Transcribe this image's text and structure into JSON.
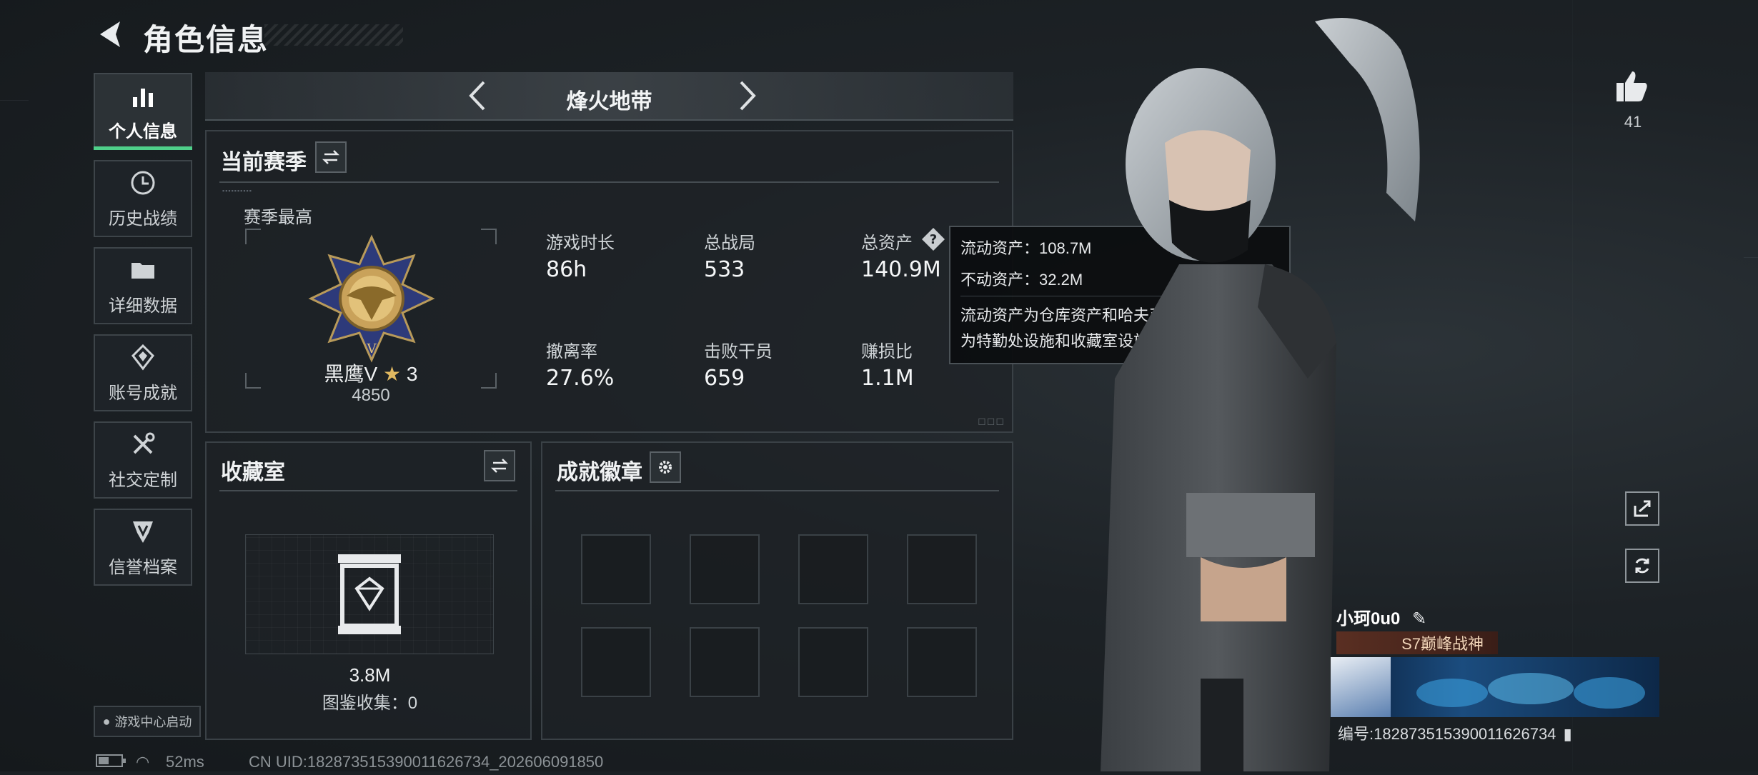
{
  "header": {
    "title": "角色信息"
  },
  "sidebar": {
    "items": [
      {
        "label": "个人信息",
        "icon": "bar-chart-icon"
      },
      {
        "label": "历史战绩",
        "icon": "clock-icon"
      },
      {
        "label": "详细数据",
        "icon": "folder-icon"
      },
      {
        "label": "账号成就",
        "icon": "achievement-icon"
      },
      {
        "label": "社交定制",
        "icon": "tools-icon"
      },
      {
        "label": "信誉档案",
        "icon": "shield-icon"
      }
    ],
    "game_center": "游戏中心启动"
  },
  "mode": {
    "title": "烽火地带"
  },
  "season_panel": {
    "title": "当前赛季",
    "best_label": "赛季最高",
    "rank_name": "黑鹰V",
    "rank_stars": "3",
    "rank_points": "4850",
    "stats": [
      {
        "label": "游戏时长",
        "value": "86h"
      },
      {
        "label": "总战局",
        "value": "533"
      },
      {
        "label": "总资产",
        "value": "140.9M"
      },
      {
        "label": "撤离率",
        "value": "27.6%"
      },
      {
        "label": "击败干员",
        "value": "659"
      },
      {
        "label": "赚损比",
        "value": "1.1M"
      }
    ]
  },
  "tooltip": {
    "liquid": "流动资产：108.7M",
    "fixed": "不动资产：32.2M",
    "desc_line1": "流动资产为仓库资产和哈夫币，不动资产",
    "desc_line2": "为特勤处设施和收藏室设施"
  },
  "collection_panel": {
    "title": "收藏室",
    "value": "3.8M",
    "catalog": "图鉴收集：0"
  },
  "badge_panel": {
    "title": "成就徽章",
    "slots": 8
  },
  "player": {
    "likes": "41",
    "name": "小珂0u0",
    "title_tag": "S7巅峰战神",
    "uid_line": "编号:182873515390011626734"
  },
  "footer": {
    "ping": "52ms",
    "uid": "CN UID:182873515390011626734_202606091850"
  },
  "colors": {
    "accent_green": "#4fd08a",
    "bg": "#1b2024",
    "panel_border": "#3a4146"
  }
}
